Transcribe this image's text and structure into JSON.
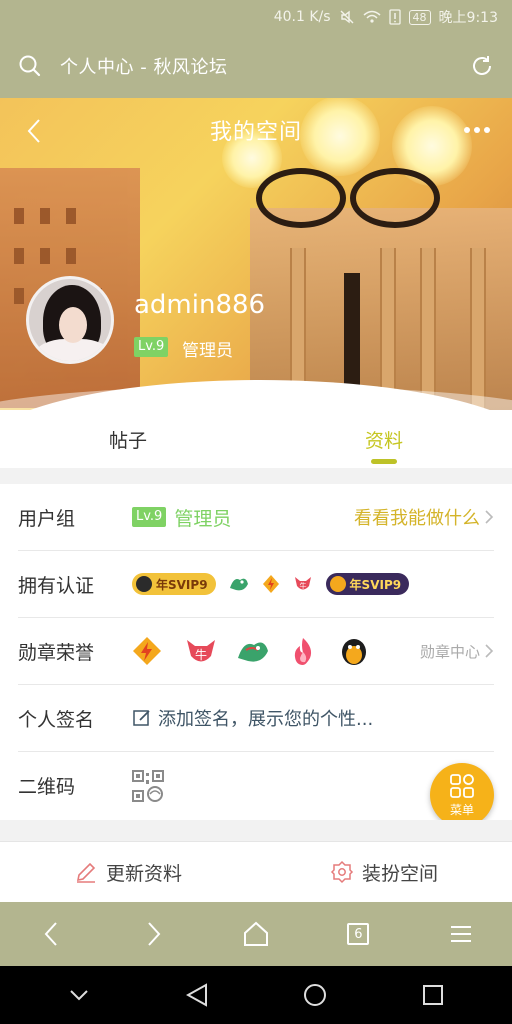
{
  "status": {
    "speed": "40.1 K/s",
    "battery": "48",
    "time": "晚上9:13"
  },
  "browser": {
    "title": "个人中心 - 秋风论坛",
    "tab_count": "6"
  },
  "profile": {
    "page_title": "我的空间",
    "username": "admin886",
    "level": "Lv.9",
    "role": "管理员"
  },
  "tabs": [
    {
      "label": "帖子",
      "active": false
    },
    {
      "label": "资料",
      "active": true
    }
  ],
  "info": {
    "usergroup": {
      "label": "用户组",
      "level": "Lv.9",
      "value": "管理员",
      "link": "看看我能做什么"
    },
    "certification": {
      "label": "拥有认证",
      "badges": [
        "年SVIP9",
        "年SVIP9"
      ]
    },
    "medals": {
      "label": "勋章荣誉",
      "link": "勋章中心"
    },
    "signature": {
      "label": "个人签名",
      "placeholder": "添加签名，展示您的个性..."
    },
    "qrcode": {
      "label": "二维码"
    }
  },
  "fab": {
    "label": "菜单"
  },
  "actions": {
    "update": "更新资料",
    "decorate": "装扮空间"
  },
  "colors": {
    "olive_bar": "#b3b58f",
    "accent_green": "#7fd264",
    "accent_yellow": "#d4b42a",
    "fab": "#f6b219"
  }
}
